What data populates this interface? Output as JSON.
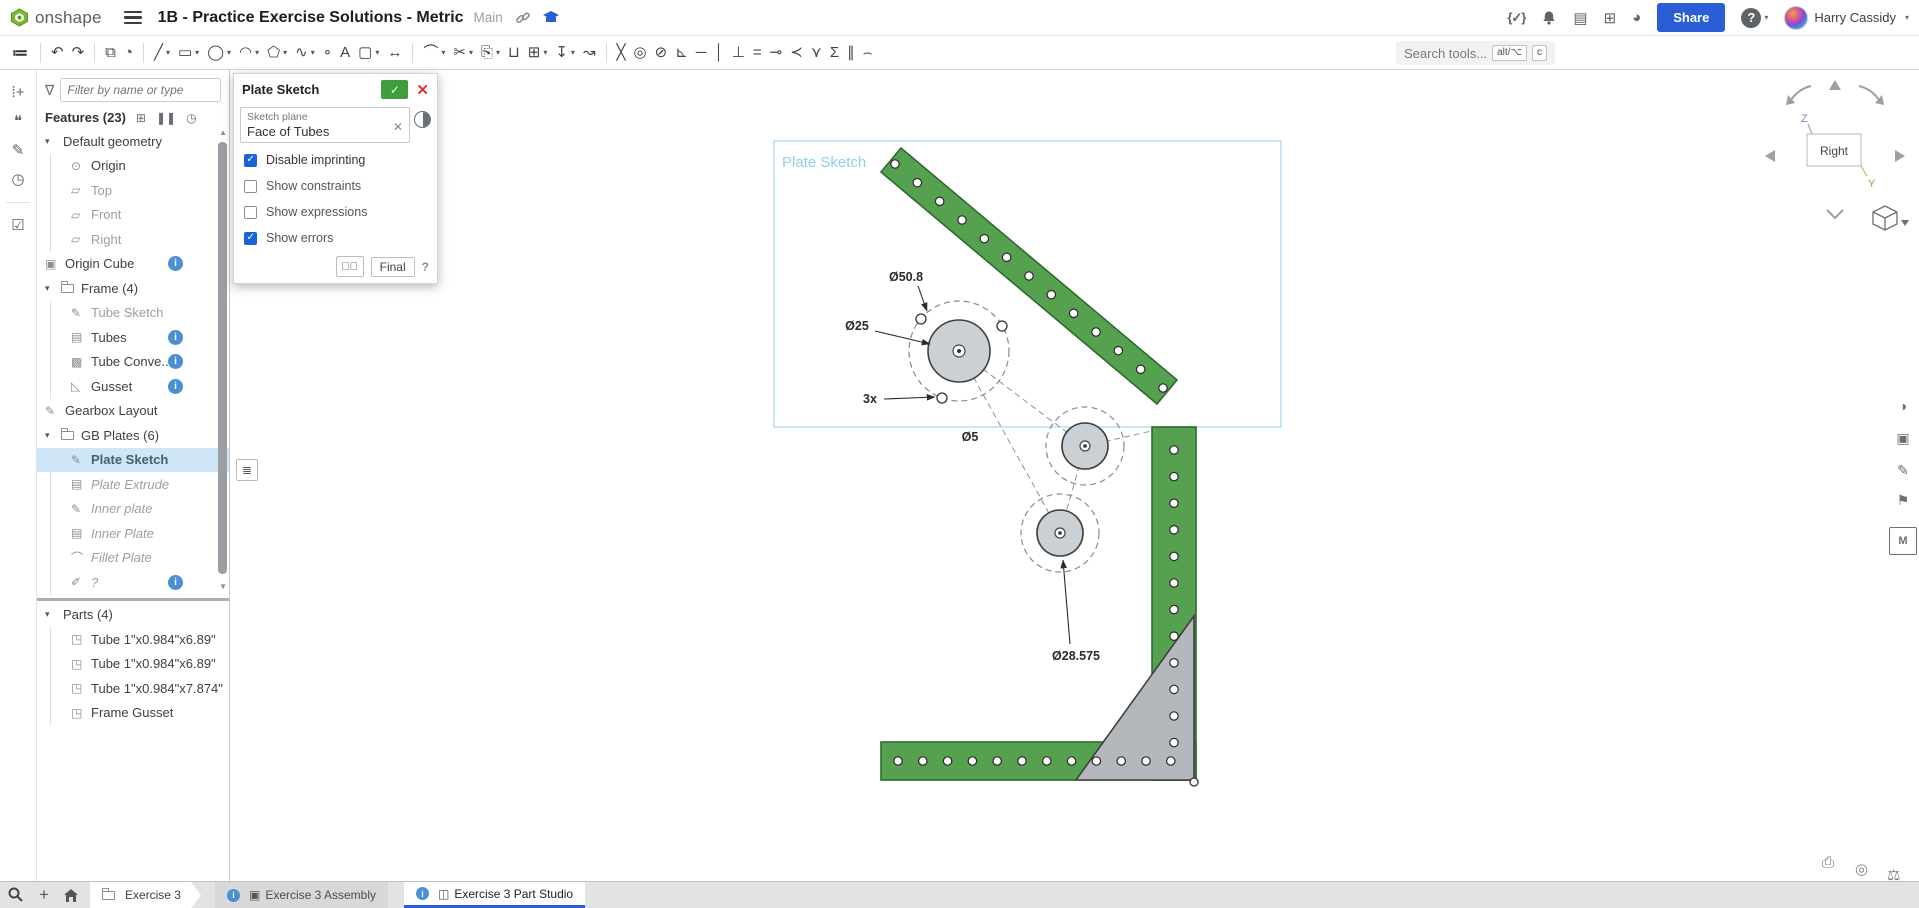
{
  "topbar": {
    "logo_text": "onshape",
    "title": "1B - Practice Exercise Solutions - Metric",
    "branch": "Main",
    "icons": {
      "versions": "{✓}",
      "tasks": "▤",
      "apps": "⊞",
      "learn": "◕"
    },
    "share_label": "Share",
    "help_label": "?",
    "user_name": "Harry Cassidy"
  },
  "toolbar": {
    "search_placeholder": "Search tools...",
    "shortcut_alt": "alt/⌥",
    "shortcut_key": "c",
    "icons": [
      {
        "n": "undo-icon",
        "g": "↶"
      },
      {
        "n": "redo-icon",
        "g": "↷",
        "d": true
      },
      {
        "n": "insert-document-icon",
        "g": "⧉"
      },
      {
        "n": "custom-feature-icon",
        "g": "◔",
        "d": true
      },
      {
        "n": "line-tool-icon",
        "g": "╱",
        "c": true
      },
      {
        "n": "rectangle-tool-icon",
        "g": "▭",
        "c": true
      },
      {
        "n": "circle-tool-icon",
        "g": "◯",
        "c": true
      },
      {
        "n": "arc-tool-icon",
        "g": "◠",
        "c": true
      },
      {
        "n": "polygon-tool-icon",
        "g": "⬠",
        "c": true
      },
      {
        "n": "spline-tool-icon",
        "g": "∿",
        "c": true
      },
      {
        "n": "point-tool-icon",
        "g": "∘"
      },
      {
        "n": "text-tool-icon",
        "g": "A"
      },
      {
        "n": "slot-tool-icon",
        "g": "▢",
        "c": true
      },
      {
        "n": "dimension-tool-icon",
        "g": "↔",
        "d": true
      },
      {
        "n": "fillet-tool-icon",
        "g": "⌒",
        "c": true
      },
      {
        "n": "trim-tool-icon",
        "g": "✂",
        "c": true
      },
      {
        "n": "paste-sketch-icon",
        "g": "⎘",
        "c": true
      },
      {
        "n": "use-project-icon",
        "g": "⊔"
      },
      {
        "n": "pattern-tool-icon",
        "g": "⊞",
        "c": true
      },
      {
        "n": "import-dxf-icon",
        "g": "↧",
        "c": true
      },
      {
        "n": "offset-arrow-icon",
        "g": "↝",
        "d": true
      },
      {
        "n": "coincident-constraint-icon",
        "g": "╳"
      },
      {
        "n": "concentric-constraint-icon",
        "g": "◎"
      },
      {
        "n": "tangent-constraint-icon",
        "g": "⊘"
      },
      {
        "n": "midpoint-constraint-icon",
        "g": "⊾"
      },
      {
        "n": "horizontal-constraint-icon",
        "g": "─"
      },
      {
        "n": "vertical-constraint-icon",
        "g": "│"
      },
      {
        "n": "perpendicular-constraint-icon",
        "g": "⊥"
      },
      {
        "n": "equal-constraint-icon",
        "g": "="
      },
      {
        "n": "fix-constraint-icon",
        "g": "⊸"
      },
      {
        "n": "symmetric-constraint-icon",
        "g": "≺"
      },
      {
        "n": "normal-constraint-icon",
        "g": "⋎"
      },
      {
        "n": "sketch-expression-icon",
        "g": "Σ"
      },
      {
        "n": "parallel-constraint-icon",
        "g": "∥"
      },
      {
        "n": "curvature-icon",
        "g": "⌢"
      }
    ]
  },
  "left_rail": [
    {
      "n": "insert-feature-icon",
      "g": "⁞+"
    },
    {
      "n": "comments-icon",
      "g": "❝"
    },
    {
      "n": "notes-icon",
      "g": "✎"
    },
    {
      "n": "history-icon",
      "g": "◷"
    },
    {
      "n": "checklist-icon",
      "g": "☑"
    }
  ],
  "features_panel": {
    "filter_placeholder": "Filter by name or type",
    "header": "Features (23)",
    "header_icons": [
      {
        "n": "add-folder-icon",
        "g": "⊞"
      },
      {
        "n": "rollback-pause-icon",
        "g": "❚❚"
      },
      {
        "n": "history-clock-icon",
        "g": "◷"
      }
    ],
    "tree": [
      {
        "label": "Default geometry",
        "chev": true,
        "lvl": 0
      },
      {
        "label": "Origin",
        "icon": "origin",
        "lvl": 1
      },
      {
        "label": "Top",
        "icon": "plane",
        "lvl": 1,
        "state": "dis"
      },
      {
        "label": "Front",
        "icon": "plane",
        "lvl": 1,
        "state": "dis"
      },
      {
        "label": "Right",
        "icon": "plane",
        "lvl": 1,
        "state": "dis"
      },
      {
        "label": "Origin Cube",
        "icon": "cube",
        "lvl": 0,
        "info": true
      },
      {
        "label": "Frame (4)",
        "chev": true,
        "icon": "folder",
        "lvl": 0
      },
      {
        "label": "Tube Sketch",
        "icon": "sketch",
        "lvl": 1,
        "state": "dis"
      },
      {
        "label": "Tubes",
        "icon": "extrude",
        "lvl": 1,
        "info": true
      },
      {
        "label": "Tube Conve...",
        "icon": "convert",
        "lvl": 1,
        "info": true
      },
      {
        "label": "Gusset",
        "icon": "gusset",
        "lvl": 1,
        "info": true
      },
      {
        "label": "Gearbox Layout",
        "icon": "sketch",
        "lvl": 0
      },
      {
        "label": "GB Plates (6)",
        "chev": true,
        "icon": "folder",
        "lvl": 0
      },
      {
        "label": "Plate Sketch",
        "icon": "sketch",
        "lvl": 1,
        "state": "sel"
      },
      {
        "label": "Plate Extrude",
        "icon": "extrude",
        "lvl": 1,
        "state": "ital"
      },
      {
        "label": "Inner plate",
        "icon": "sketch",
        "lvl": 1,
        "state": "ital"
      },
      {
        "label": "Inner Plate",
        "icon": "extrude",
        "lvl": 1,
        "state": "ital"
      },
      {
        "label": "Fillet Plate",
        "icon": "fillet",
        "lvl": 1,
        "state": "ital"
      },
      {
        "label": "?",
        "icon": "unknown",
        "lvl": 1,
        "state": "ital",
        "info": true
      }
    ],
    "parts_header": "Parts (4)",
    "parts": [
      {
        "label": "Tube 1\"x0.984\"x6.89\""
      },
      {
        "label": "Tube 1\"x0.984\"x6.89\""
      },
      {
        "label": "Tube 1\"x0.984\"x7.874\""
      },
      {
        "label": "Frame Gusset"
      }
    ]
  },
  "dialog": {
    "title": "Plate Sketch",
    "plane_label": "Sketch plane",
    "plane_value": "Face of Tubes",
    "checkboxes": [
      {
        "label": "Disable imprinting",
        "checked": true
      },
      {
        "label": "Show constraints",
        "checked": false
      },
      {
        "label": "Show expressions",
        "checked": false
      },
      {
        "label": "Show errors",
        "checked": true
      }
    ],
    "final_label": "Final",
    "help_label": "?"
  },
  "canvas": {
    "sketch_label": "Plate Sketch",
    "dims": {
      "d50": "Ø50.8",
      "d25": "Ø25",
      "count": "3x",
      "d5": "Ø5",
      "d28": "Ø28.575"
    },
    "colors": {
      "plate_green": "#56a150",
      "plate_edge": "#2c6b2c",
      "gusset_gray": "#b4b8bc",
      "disc_gray": "#cbd0d4",
      "selection_blue": "#b5ddef"
    }
  },
  "view_cube": {
    "label": "Right",
    "axis_z": "Z",
    "axis_y": "Y"
  },
  "right_rail": [
    {
      "n": "appearance-icon",
      "g": "◑"
    },
    {
      "n": "display-states-icon",
      "g": "▣"
    },
    {
      "n": "edit-appearance-icon",
      "g": "✎"
    },
    {
      "n": "named-views-icon",
      "g": "⚑"
    },
    {
      "n": "material-library-icon",
      "g": "M",
      "boxed": true
    }
  ],
  "corner_icons": [
    {
      "n": "print-icon",
      "g": "⎙"
    },
    {
      "n": "visibility-icon",
      "g": "◎"
    },
    {
      "n": "measure-icon",
      "g": "⚖"
    }
  ],
  "bottom_bar": {
    "tabs": [
      {
        "label": "Exercise 3"
      },
      {
        "label": "Exercise 3 Assembly"
      },
      {
        "label": "Exercise 3 Part Studio"
      }
    ]
  }
}
